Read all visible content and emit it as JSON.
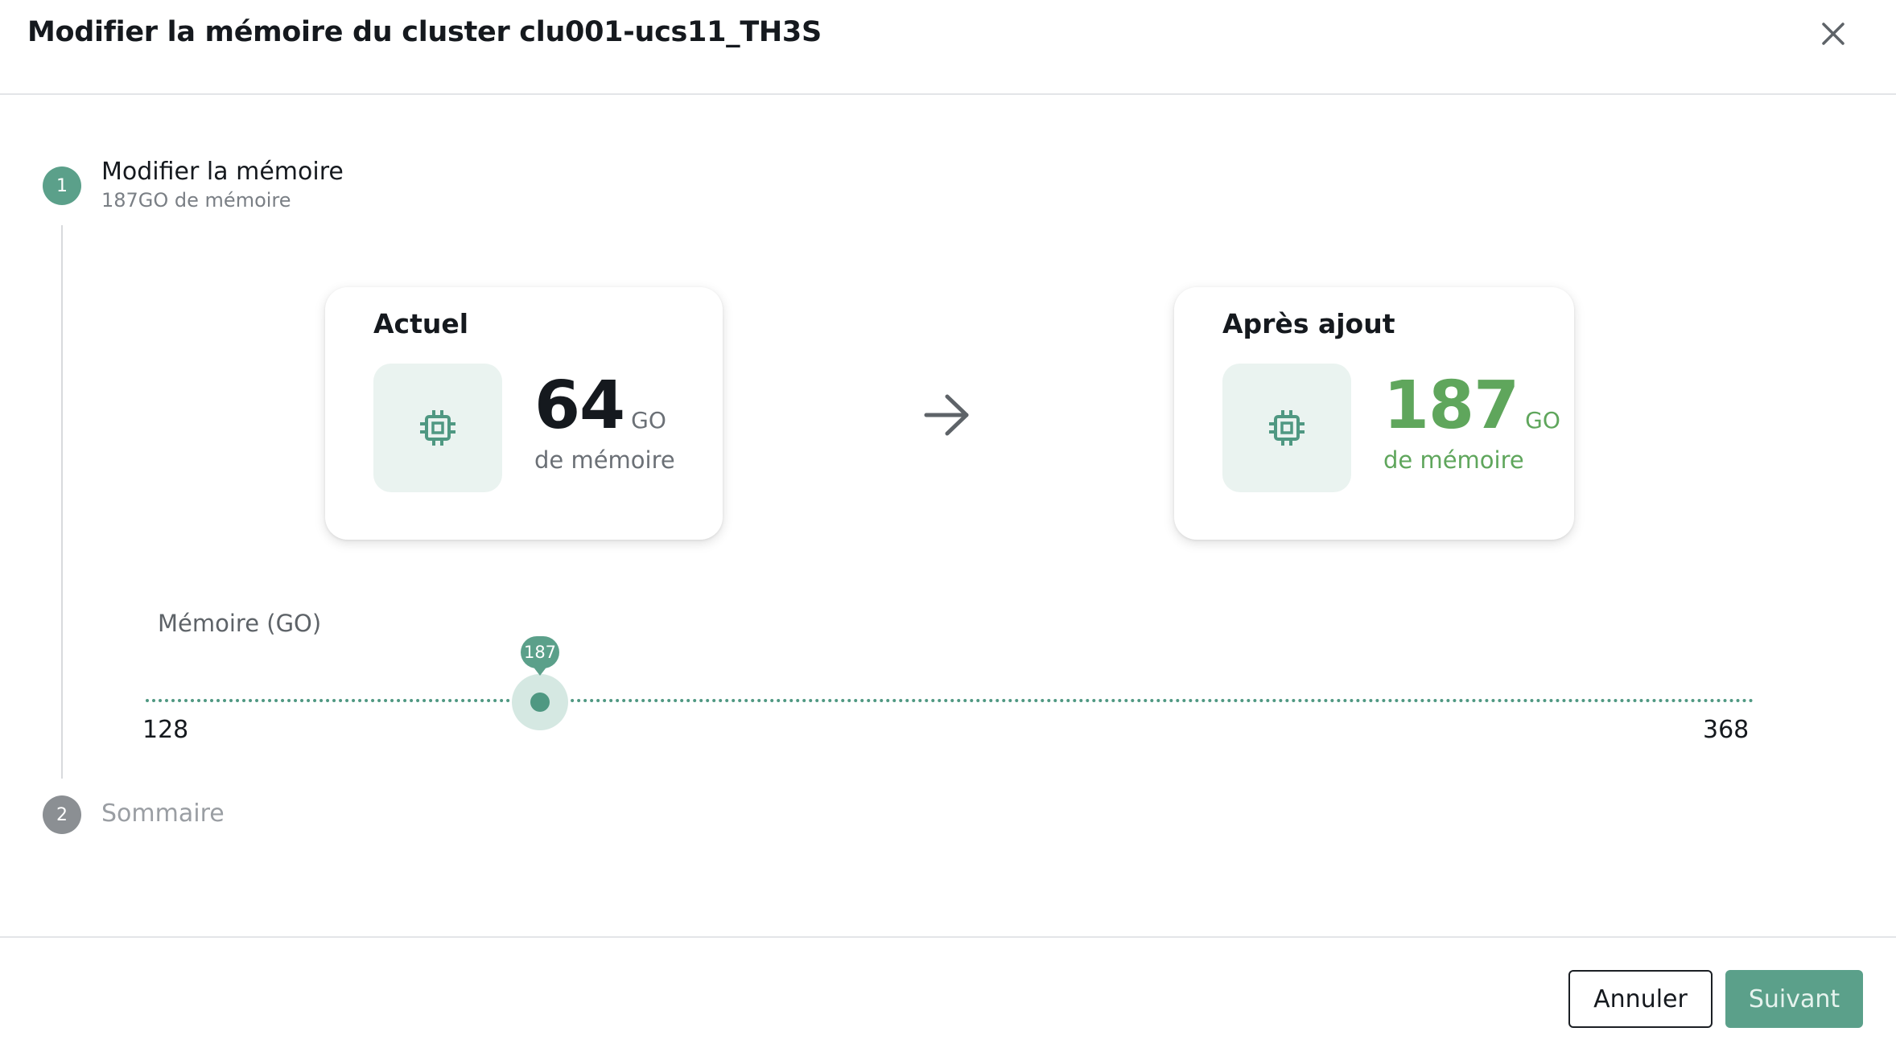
{
  "dialog": {
    "title": "Modifier la mémoire du cluster clu001-ucs11_TH3S",
    "close_icon": "close-icon"
  },
  "steps": [
    {
      "number": "1",
      "title": "Modifier la mémoire",
      "subtitle": "187GO de mémoire",
      "state": "active"
    },
    {
      "number": "2",
      "title": "Sommaire",
      "state": "inactive"
    }
  ],
  "current_card": {
    "label": "Actuel",
    "value": "64",
    "unit": "GO",
    "caption": "de mémoire",
    "icon": "memory-chip-icon"
  },
  "after_card": {
    "label": "Après ajout",
    "value": "187",
    "unit": "GO",
    "caption": "de mémoire",
    "icon": "memory-chip-icon"
  },
  "transition_icon": "arrow-right-icon",
  "slider": {
    "label": "Mémoire (GO)",
    "min": "128",
    "max": "368",
    "value": "187"
  },
  "footer": {
    "cancel_label": "Annuler",
    "next_label": "Suivant"
  },
  "colors": {
    "accent": "#5ba08a",
    "positive": "#5fa65c",
    "inactive": "#8b8f93"
  }
}
